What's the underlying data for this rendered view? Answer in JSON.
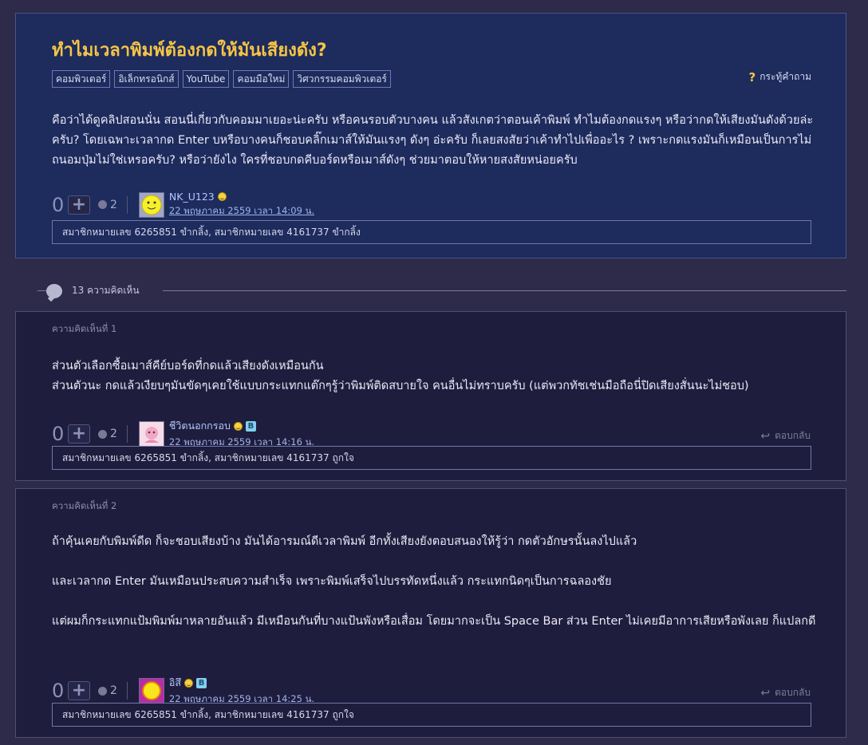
{
  "topic": {
    "title": "ทำไมเวลาพิมพ์ต้องกดให้มันเสียงดัง?",
    "tags": [
      "คอมพิวเตอร์",
      "อิเล็กทรอนิกส์",
      "YouTube",
      "คอมมือใหม่",
      "วิศวกรรมคอมพิวเตอร์"
    ],
    "type_label": "กระทู้คำถาม",
    "body": "คือว่าได้ดูคลิปสอนนั่น สอนนี่เกี่ยวกับคอมมาเยอะน่ะครับ หรือคนรอบตัวบางคน แล้วสังเกตว่าตอนเค้าพิมพ์ ทำไมต้องกดแรงๆ หรือว่ากดให้เสียงมันดังด้วยล่ะครับ? โดยเฉพาะเวลากด Enter บหรือบางคนก็ชอบคลิ๊กเมาส์ให้มันแรงๆ ดังๆ อ่ะครับ ก็เลยสงสัยว่าเค้าทำไปเพื่ออะไร ? เพราะกดแรงมันก็เหมือนเป็นการไม่ถนอมปุ่มไม่ใช่เหรอครับ? หรือว่ายังไง ใครที่ชอบกดคีบอร์ดหรือเมาส์ดังๆ ช่วยมาตอบให้หายสงสัยหน่อยครับ",
    "vote_count": "0",
    "emotion_count": "2",
    "author": "NK_U123",
    "date": "22 พฤษภาคม 2559 เวลา 14:09 น.",
    "likes": "สมาชิกหมายเลข 6265851 ขำกลิ้ง, สมาชิกหมายเลข 4161737 ขำกลิ้ง"
  },
  "comments_header": {
    "count_label": "13 ความคิดเห็น"
  },
  "comments": [
    {
      "number_label": "ความคิดเห็นที่ 1",
      "lines": [
        "ส่วนตัวเลือกซื้อเมาส์คีย์บอร์ดที่กดแล้วเสียงดังเหมือนกัน",
        "ส่วนตัวนะ กดแล้วเงียบๆมันขัดๆเคยใช้แบบกระแทกแต๊กๆรู้ว่าพิมพ์ติดสบายใจ คนอื่นไม่ทราบครับ (แต่พวกทัชเช่นมือถือนี่ปิดเสียงสั่นนะไม่ชอบ)"
      ],
      "vote_count": "0",
      "emotion_count": "2",
      "author": "ชีวิตนอกกรอบ",
      "badge": "B",
      "date": "22 พฤษภาคม 2559 เวลา 14:16 น.",
      "reply_label": "ตอบกลับ",
      "likes": "สมาชิกหมายเลข 6265851 ขำกลิ้ง, สมาชิกหมายเลข 4161737 ถูกใจ"
    },
    {
      "number_label": "ความคิดเห็นที่ 2",
      "lines": [
        "ถ้าคุ้นเคยกับพิมพ์ดีด ก็จะชอบเสียงบ้าง มันได้อารมณ์ดีเวลาพิมพ์ อีกทั้งเสียงยังตอบสนองให้รู้ว่า กดตัวอักษรนั้นลงไปแล้ว",
        "และเวลากด Enter มันเหมือนประสบความสำเร็จ เพราะพิมพ์เสร็จไปบรรทัดหนึ่งแล้ว กระแทกนิดๆเป็นการฉลองชัย",
        "แต่ผมก็กระแทกแป้มพิมพ์มาหลายอันแล้ว มีเหมือนกันที่บางแป้นพังหรือเสื่อม โดยมากจะเป็น Space Bar ส่วน Enter ไม่เคยมีอาการเสียหรือพังเลย ก็แปลกดี"
      ],
      "vote_count": "0",
      "emotion_count": "2",
      "author": "อิสึ",
      "badge": "B",
      "date": "22 พฤษภาคม 2559 เวลา 14:25 น.",
      "reply_label": "ตอบกลับ",
      "likes": "สมาชิกหมายเลข 6265851 ขำกลิ้ง, สมาชิกหมายเลข 4161737 ถูกใจ"
    }
  ],
  "icons": {
    "question": "question-icon",
    "plus": "plus-icon",
    "emotion": "emotion-icon",
    "comment_bubble": "comment-bubble-icon",
    "reply": "reply-icon"
  },
  "colors": {
    "title": "#f5c545",
    "topic_bg": "#1d2b5d",
    "comment_bg": "#1f1d3d",
    "page_bg": "#2d2a4a",
    "link": "#9fb4ec"
  }
}
